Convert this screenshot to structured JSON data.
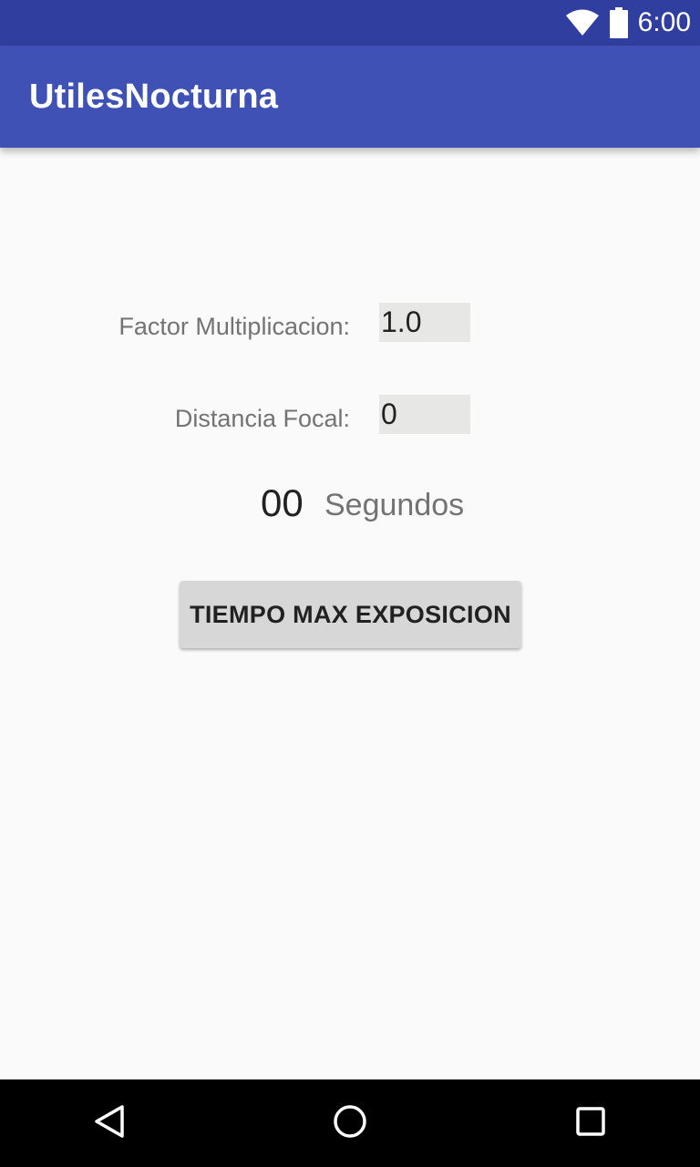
{
  "status_bar": {
    "time": "6:00",
    "icons": [
      "wifi-icon",
      "battery-icon"
    ],
    "background": "#303f9f"
  },
  "app_bar": {
    "title": "UtilesNocturna",
    "background": "#3f51b5"
  },
  "form": {
    "factor_label": "Factor Multiplicacion:",
    "factor_value": "1.0",
    "focal_label": "Distancia Focal:",
    "focal_value": "0"
  },
  "result": {
    "value": "00",
    "unit": "Segundos"
  },
  "action": {
    "button_label": "TIEMPO MAX EXPOSICION"
  },
  "nav_bar": {
    "icons": [
      "back-icon",
      "home-icon",
      "recents-icon"
    ]
  }
}
